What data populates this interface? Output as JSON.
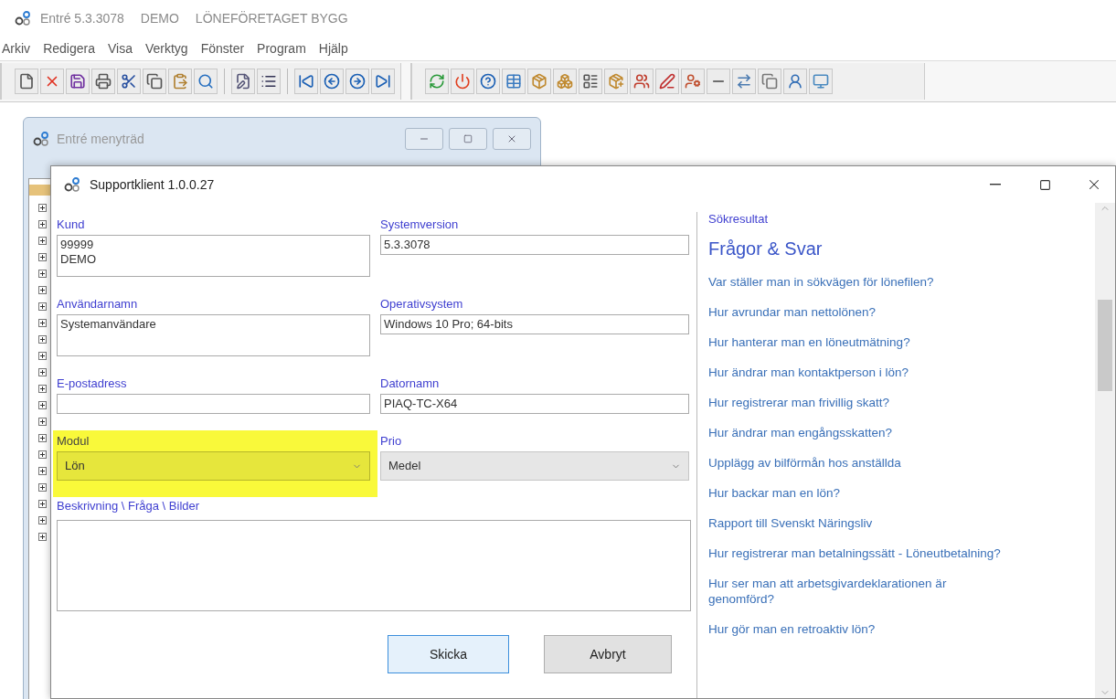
{
  "app": {
    "title_parts": [
      "Entré 5.3.3078",
      "DEMO",
      "LÖNEFÖRETAGET BYGG"
    ]
  },
  "menu": [
    "Arkiv",
    "Redigera",
    "Visa",
    "Verktyg",
    "Fönster",
    "Program",
    "Hjälp"
  ],
  "tree_window": {
    "title": "Entré menyträd"
  },
  "dialog": {
    "title": "Supportklient 1.0.0.27",
    "fields": [
      {
        "label": "Kund",
        "kind": "multiline",
        "lines": [
          "99999",
          "DEMO"
        ],
        "highlighted": false
      },
      {
        "label": "Systemversion",
        "kind": "text",
        "value": "5.3.3078",
        "highlighted": false
      },
      {
        "label": "Användarnamn",
        "kind": "multiline",
        "lines": [
          "Systemanvändare"
        ],
        "highlighted": false
      },
      {
        "label": "Operativsystem",
        "kind": "text",
        "value": "Windows 10 Pro; 64-bits",
        "highlighted": false
      },
      {
        "label": "E-postadress",
        "kind": "text",
        "highlighted": false
      },
      {
        "label": "Datornamn",
        "kind": "text",
        "value": "PIAQ-TC-X64",
        "highlighted": false
      },
      {
        "label": "Modul",
        "kind": "select",
        "value": "Lön",
        "highlighted": true
      },
      {
        "label": "Prio",
        "kind": "select",
        "value": "Medel",
        "highlighted": false
      }
    ],
    "description_label": "Beskrivning \\ Fråga \\ Bilder",
    "buttons": [
      {
        "label": "Skicka",
        "focused": true
      },
      {
        "label": "Avbryt",
        "focused": false
      }
    ],
    "results": {
      "label": "Sökresultat",
      "heading": "Frågor & Svar",
      "links": [
        "Var ställer man in sökvägen för lönefilen?",
        "Hur avrundar man nettolönen?",
        "Hur hanterar man en löneutmätning?",
        "Hur ändrar man kontaktperson i lön?",
        "Hur registrerar man frivillig skatt?",
        "Hur ändrar man engångsskatten?",
        "Upplägg av bilförmån hos anställda",
        "Hur backar man en lön?",
        "Rapport till Svenskt Näringsliv",
        "Hur registrerar man betalningssätt - Löneutbetalning?",
        "Hur ser man att arbetsgivardeklarationen är genomförd?",
        "Hur gör man en retroaktiv lön?"
      ]
    }
  }
}
